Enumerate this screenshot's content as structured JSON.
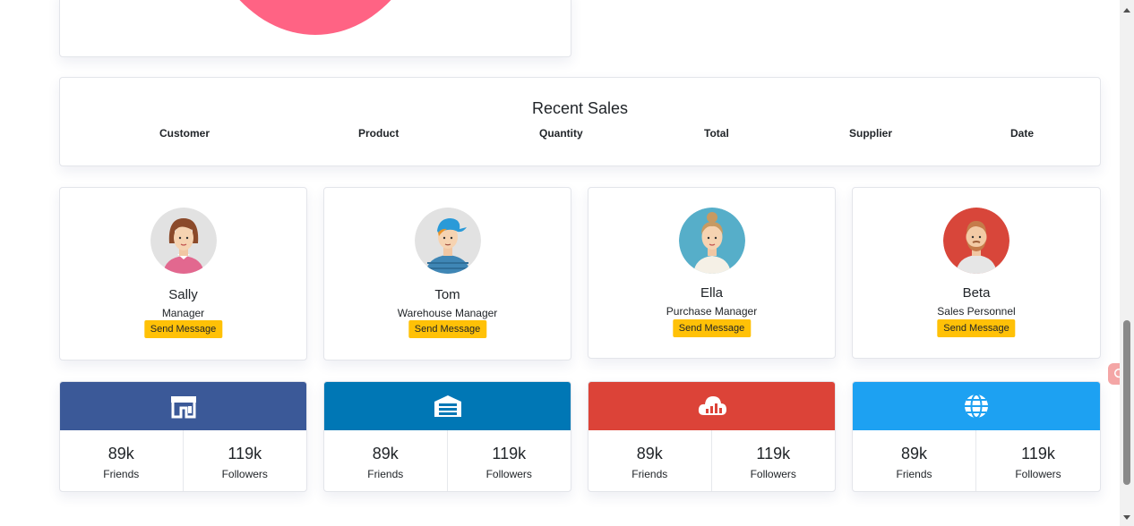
{
  "recent_sales": {
    "title": "Recent Sales",
    "columns": [
      "Customer",
      "Product",
      "Quantity",
      "Total",
      "Supplier",
      "Date"
    ]
  },
  "team": [
    {
      "name": "Sally",
      "role": "Manager",
      "button": "Send Message"
    },
    {
      "name": "Tom",
      "role": "Warehouse Manager",
      "button": "Send Message"
    },
    {
      "name": "Ella",
      "role": "Purchase Manager",
      "button": "Send Message"
    },
    {
      "name": "Beta",
      "role": "Sales Personnel",
      "button": "Send Message"
    }
  ],
  "social": [
    {
      "icon": "store-icon",
      "color": "#3b5998",
      "friends_value": "89k",
      "friends_label": "Friends",
      "followers_value": "119k",
      "followers_label": "Followers"
    },
    {
      "icon": "warehouse-icon",
      "color": "#0077b5",
      "friends_value": "89k",
      "friends_label": "Friends",
      "followers_value": "119k",
      "followers_label": "Followers"
    },
    {
      "icon": "cloud-chart-icon",
      "color": "#dc4338",
      "friends_value": "89k",
      "friends_label": "Friends",
      "followers_value": "119k",
      "followers_label": "Followers"
    },
    {
      "icon": "globe-icon",
      "color": "#1da1f2",
      "friends_value": "89k",
      "friends_label": "Friends",
      "followers_value": "119k",
      "followers_label": "Followers"
    }
  ],
  "colors": {
    "accent_button": "#ffc107",
    "pie_slice": "#ff6384"
  }
}
